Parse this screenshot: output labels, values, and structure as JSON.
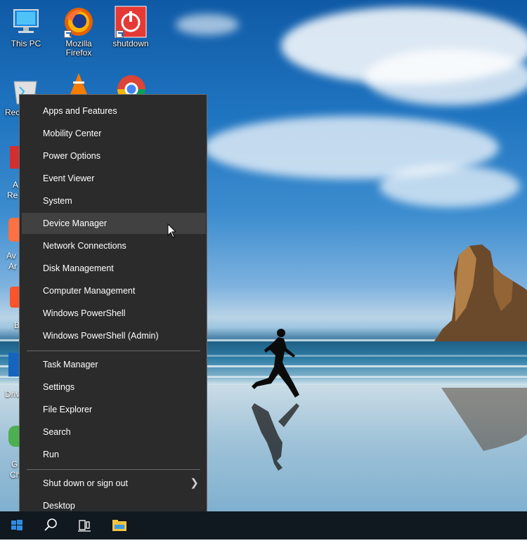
{
  "desktop": {
    "icons": [
      {
        "label": "This PC"
      },
      {
        "label": "Mozilla Firefox"
      },
      {
        "label": "shutdown"
      },
      {
        "label": "Rec"
      }
    ],
    "partial_labels": [
      "A",
      "Re",
      "Av",
      "Ar",
      "B",
      "Driv",
      "G",
      "Ch"
    ]
  },
  "context_menu": {
    "group1": [
      {
        "label": "Apps and Features"
      },
      {
        "label": "Mobility Center"
      },
      {
        "label": "Power Options"
      },
      {
        "label": "Event Viewer"
      },
      {
        "label": "System"
      },
      {
        "label": "Device Manager",
        "highlighted": true
      },
      {
        "label": "Network Connections"
      },
      {
        "label": "Disk Management"
      },
      {
        "label": "Computer Management"
      },
      {
        "label": "Windows PowerShell"
      },
      {
        "label": "Windows PowerShell (Admin)"
      }
    ],
    "group2": [
      {
        "label": "Task Manager"
      },
      {
        "label": "Settings"
      },
      {
        "label": "File Explorer"
      },
      {
        "label": "Search"
      },
      {
        "label": "Run"
      }
    ],
    "group3": [
      {
        "label": "Shut down or sign out",
        "submenu": true
      },
      {
        "label": "Desktop"
      }
    ]
  },
  "taskbar": {
    "buttons": [
      "windows-start-icon",
      "search-icon",
      "task-view-icon",
      "file-explorer-icon"
    ],
    "start_color": "#2f8de4"
  },
  "colors": {
    "menu_bg": "#2b2b2b",
    "menu_highlight": "#414141",
    "menu_text": "#ffffff",
    "taskbar_bg": "#101820"
  }
}
